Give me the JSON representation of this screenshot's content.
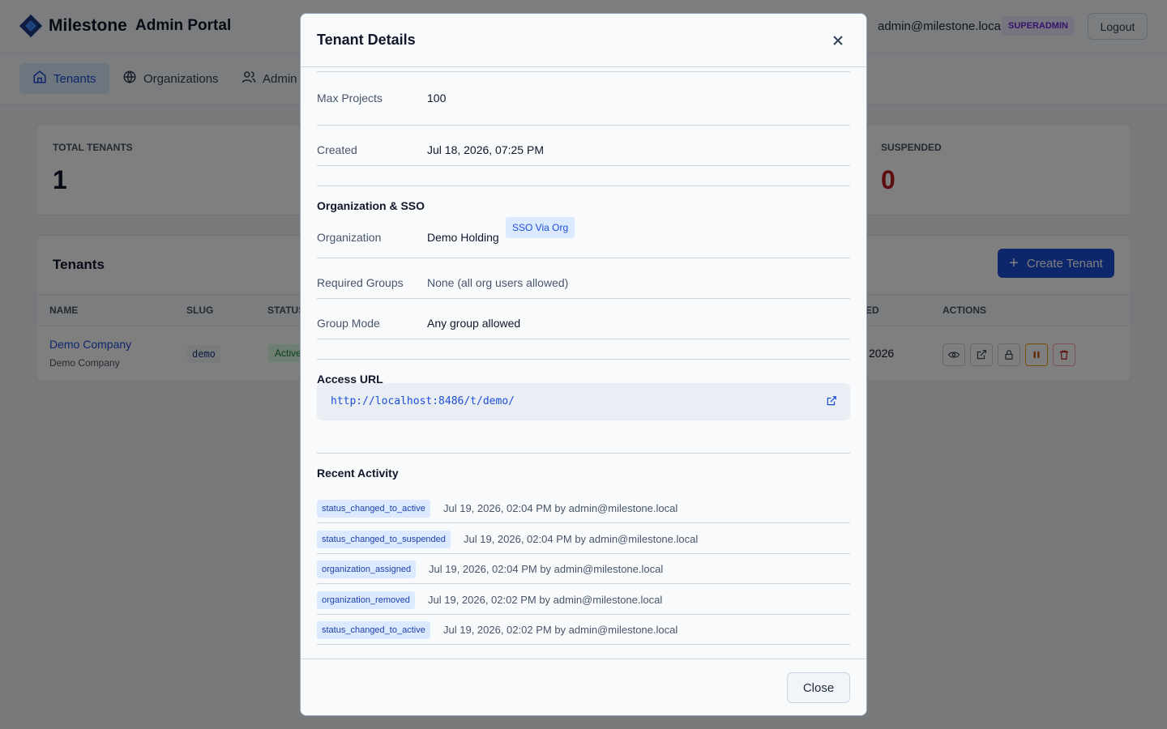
{
  "header": {
    "brand": "Milestone",
    "portal_title": "Admin Portal",
    "user_email": "admin@milestone.local",
    "role_badge": "SUPERADMIN",
    "logout_label": "Logout"
  },
  "nav": {
    "tabs": [
      {
        "label": "Tenants",
        "icon": "home-icon",
        "active": true
      },
      {
        "label": "Organizations",
        "icon": "globe-icon"
      },
      {
        "label": "Admin",
        "icon": "users-icon"
      }
    ]
  },
  "stats": [
    {
      "label": "TOTAL TENANTS",
      "value": "1"
    },
    {
      "label": "SUSPENDED",
      "value": "0",
      "color": "#b91c1c"
    }
  ],
  "tenants_table": {
    "title": "Tenants",
    "create_label": "Create Tenant",
    "columns": [
      "NAME",
      "SLUG",
      "STATUS",
      "ED",
      "ACTIONS"
    ],
    "rows": [
      {
        "name": "Demo Company",
        "subtitle": "Demo Company",
        "slug": "demo",
        "status": "Active",
        "created": "2026"
      }
    ]
  },
  "modal": {
    "title": "Tenant Details",
    "details": [
      {
        "label": "Max Projects",
        "value": "100"
      },
      {
        "label": "Created",
        "value": "Jul 18, 2026, 07:25 PM"
      }
    ],
    "org_section": {
      "title": "Organization & SSO",
      "organization_label": "Organization",
      "organization_value": "Demo Holding",
      "sso_badge": "SSO Via Org",
      "required_groups_label": "Required Groups",
      "required_groups_value": "None (all org users allowed)",
      "group_mode_label": "Group Mode",
      "group_mode_value": "Any group allowed"
    },
    "access": {
      "title": "Access URL",
      "url": "http://localhost:8486/t/demo/"
    },
    "activity": {
      "title": "Recent Activity",
      "items": [
        {
          "action": "status_changed_to_active",
          "detail": "Jul 19, 2026, 02:04 PM by admin@milestone.local"
        },
        {
          "action": "status_changed_to_suspended",
          "detail": "Jul 19, 2026, 02:04 PM by admin@milestone.local"
        },
        {
          "action": "organization_assigned",
          "detail": "Jul 19, 2026, 02:04 PM by admin@milestone.local"
        },
        {
          "action": "organization_removed",
          "detail": "Jul 19, 2026, 02:02 PM by admin@milestone.local"
        },
        {
          "action": "status_changed_to_active",
          "detail": "Jul 19, 2026, 02:02 PM by admin@milestone.local"
        }
      ]
    },
    "close_label": "Close"
  },
  "colors": {
    "accent": "#1d4ed8",
    "danger": "#b91c1c",
    "role_badge": "#6d28d9"
  }
}
